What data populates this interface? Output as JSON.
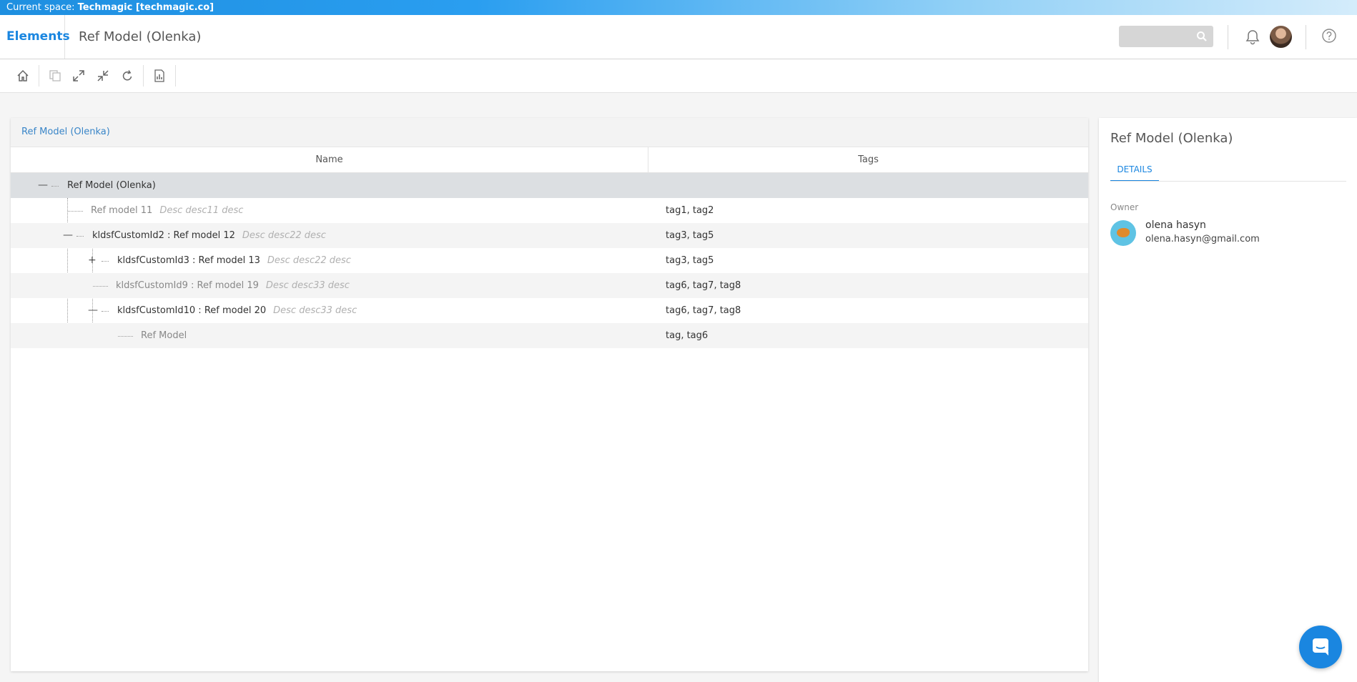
{
  "space": {
    "label": "Current space:",
    "value": "Techmagic [techmagic.co]"
  },
  "header": {
    "brand": "Elements",
    "title": "Ref Model (Olenka)",
    "search_placeholder": ""
  },
  "icons": {
    "search": "search-icon",
    "bell": "bell-icon",
    "help": "help-icon",
    "home": "home-icon",
    "copy": "copy-icon",
    "expand": "expand-icon",
    "collapse": "collapse-icon",
    "refresh": "refresh-icon",
    "report": "report-icon",
    "chat": "chat-icon"
  },
  "panel": {
    "breadcrumb": "Ref Model (Olenka)",
    "columns": [
      "Name",
      "Tags"
    ]
  },
  "tree": [
    {
      "id": "",
      "name": "Ref Model (Olenka)",
      "desc": "",
      "tags": "",
      "toggle": "—"
    },
    {
      "id": "",
      "name": "Ref model 11",
      "desc": "Desc desc11 desc",
      "tags": "tag1, tag2",
      "toggle": ""
    },
    {
      "id": "kldsfCustomId2",
      "name": "kldsfCustomId2 : Ref model 12",
      "desc": "Desc desc22 desc",
      "tags": "tag3, tag5",
      "toggle": "—"
    },
    {
      "id": "kldsfCustomId3",
      "name": "kldsfCustomId3 : Ref model 13",
      "desc": "Desc desc22 desc",
      "tags": "tag3, tag5",
      "toggle": "+"
    },
    {
      "id": "kldsfCustomId9",
      "name": "kldsfCustomId9 : Ref model 19",
      "desc": "Desc desc33 desc",
      "tags": "tag6, tag7, tag8",
      "toggle": ""
    },
    {
      "id": "kldsfCustomId10",
      "name": "kldsfCustomId10 : Ref model 20",
      "desc": "Desc desc33 desc",
      "tags": "tag6, tag7, tag8",
      "toggle": "—"
    },
    {
      "id": "",
      "name": "Ref Model",
      "desc": "",
      "tags": "tag, tag6",
      "toggle": ""
    }
  ],
  "side": {
    "title": "Ref Model (Olenka)",
    "tab": "DETAILS",
    "owner_label": "Owner",
    "owner_name": "olena hasyn",
    "owner_email": "olena.hasyn@gmail.com"
  },
  "colors": {
    "accent": "#1a86e0",
    "link": "#3a86c8",
    "selected_row": "#dcdfe2"
  }
}
